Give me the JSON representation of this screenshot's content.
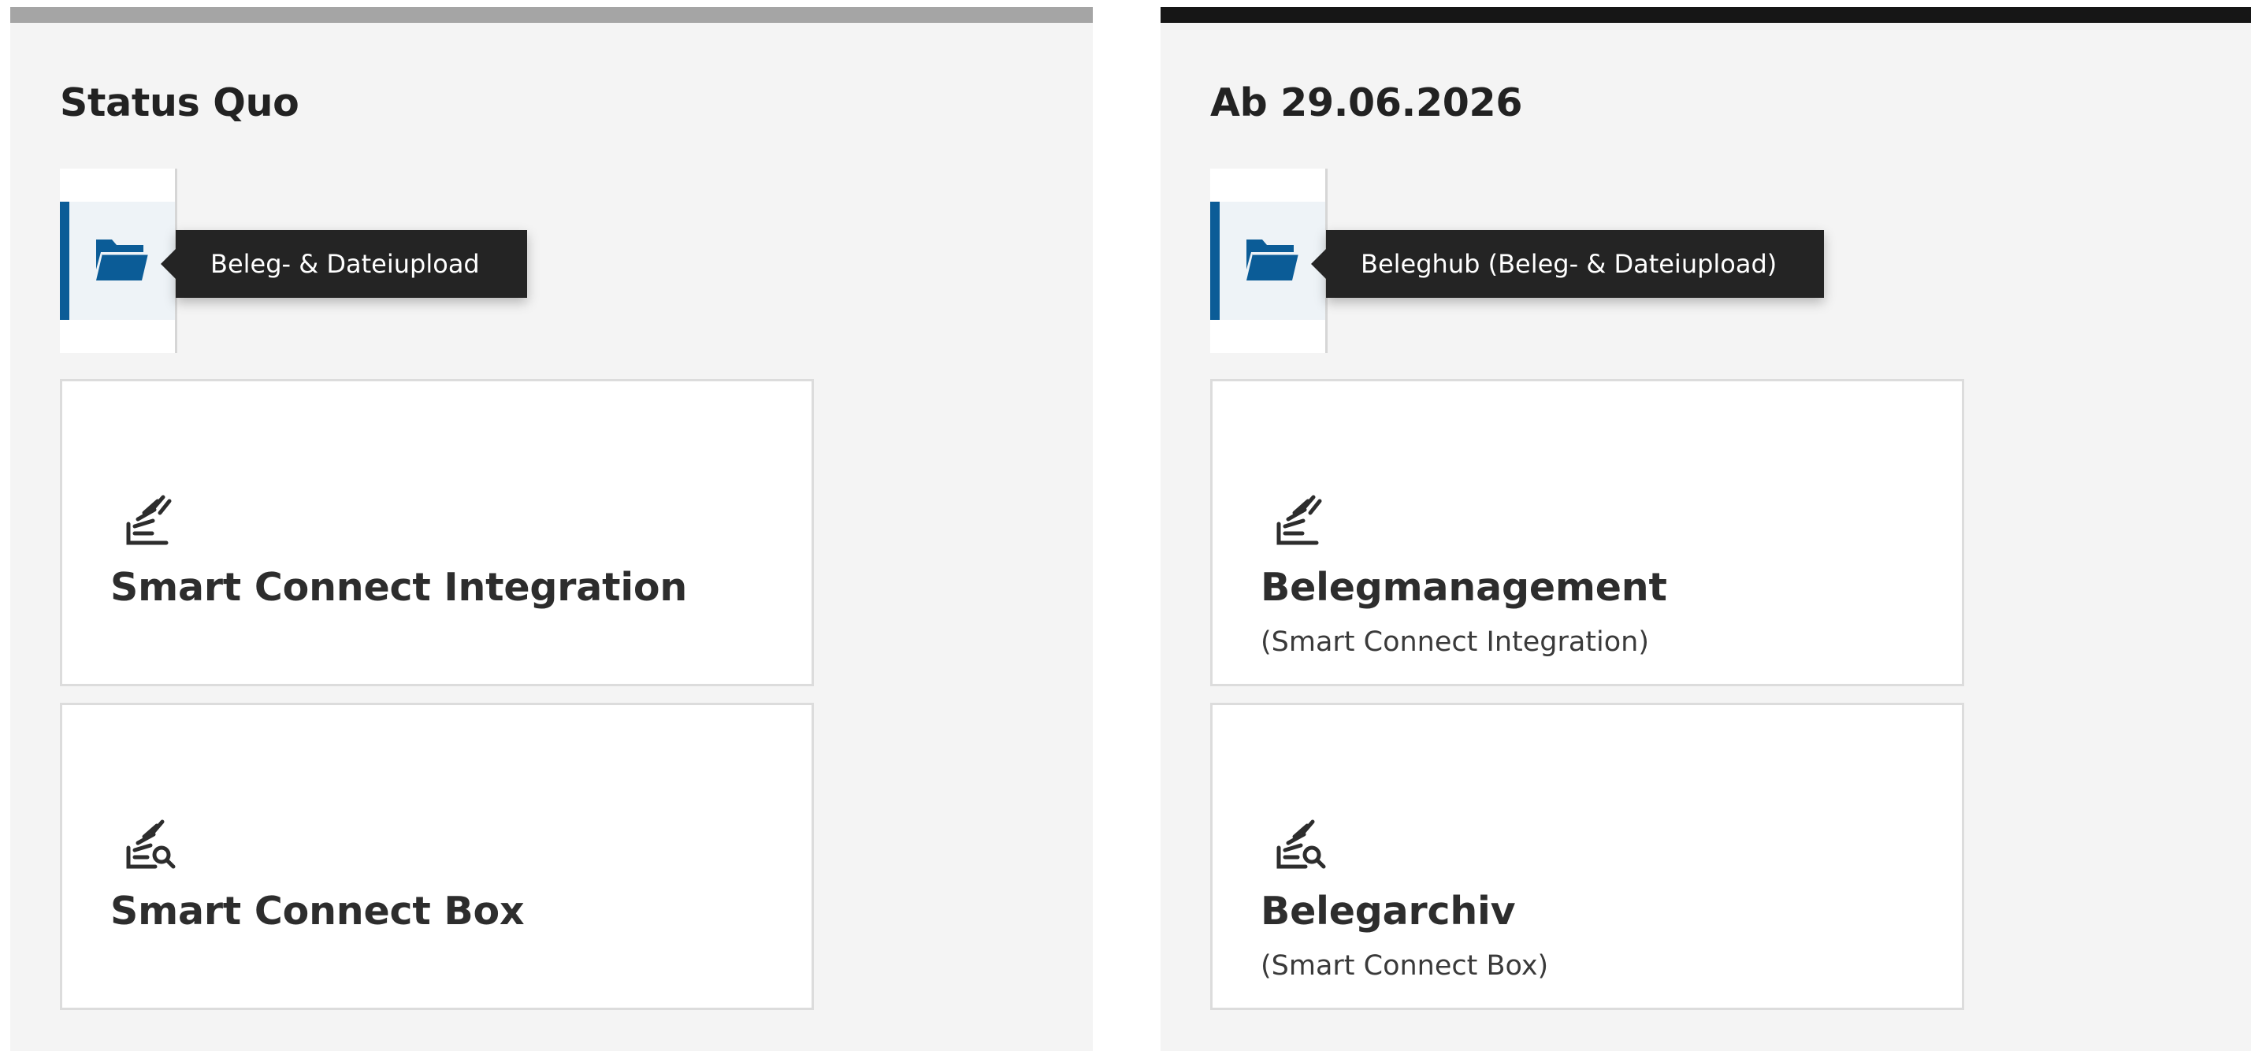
{
  "colors": {
    "panel_background": "#f4f4f4",
    "status_quo_bar": "#a5a5a5",
    "future_bar": "#161616",
    "accent_blue": "#0b5c97",
    "tooltip_background": "#242424"
  },
  "panels": [
    {
      "title": "Status Quo",
      "nav_icon": "folder-icon",
      "tooltip": "Beleg- & Dateiupload",
      "cards": [
        {
          "icon": "stack-upload-icon",
          "title": "Smart Connect Integration",
          "subtitle": ""
        },
        {
          "icon": "stack-search-icon",
          "title": "Smart Connect Box",
          "subtitle": ""
        }
      ]
    },
    {
      "title": "Ab 29.06.2026",
      "nav_icon": "folder-icon",
      "tooltip": "Beleghub (Beleg- & Dateiupload)",
      "cards": [
        {
          "icon": "stack-upload-icon",
          "title": "Belegmanagement",
          "subtitle": "(Smart Connect Integration)"
        },
        {
          "icon": "stack-search-icon",
          "title": "Belegarchiv",
          "subtitle": "(Smart Connect Box)"
        }
      ]
    }
  ]
}
